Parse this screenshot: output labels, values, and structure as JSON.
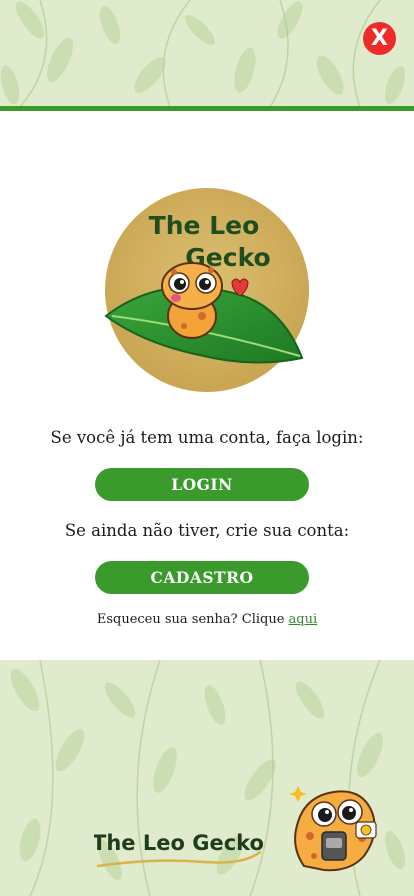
{
  "header": {
    "close_icon": "close-icon",
    "close_label": "X",
    "accent_color": "#3a9a2c",
    "close_color": "#ee2b2b"
  },
  "logo": {
    "title_line1": "The Leo",
    "title_line2": "Gecko",
    "icon": "gecko-mascot-icon"
  },
  "login_section": {
    "prompt": "Se você já tem uma conta, faça login:",
    "button_label": "LOGIN"
  },
  "signup_section": {
    "prompt": "Se ainda não tiver, crie sua conta:",
    "button_label": "CADASTRO"
  },
  "forgot": {
    "text": "Esqueceu sua senha? Clique ",
    "link_label": "aqui"
  },
  "footer": {
    "brand_text": "The Leo Gecko",
    "mascot_icon": "gecko-phone-icon"
  }
}
